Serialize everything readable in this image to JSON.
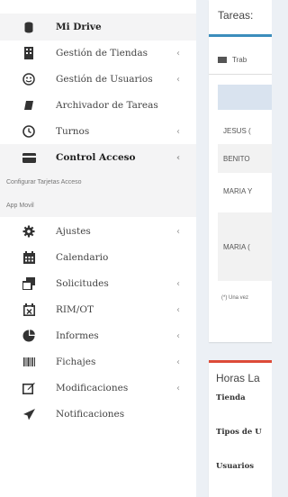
{
  "sidebar": {
    "items": [
      {
        "label": "Mi Drive",
        "icon": "database-icon",
        "chevron": ""
      },
      {
        "label": "Gestión de Tiendas",
        "icon": "building-icon",
        "chevron": "‹"
      },
      {
        "label": "Gestión de Usuarios",
        "icon": "smiley-icon",
        "chevron": "‹"
      },
      {
        "label": "Archivador de Tareas",
        "icon": "archive-icon",
        "chevron": ""
      },
      {
        "label": "Turnos",
        "icon": "clock-icon",
        "chevron": "‹"
      },
      {
        "label": "Control Acceso",
        "icon": "credit-card-icon",
        "chevron": "‹"
      },
      {
        "label": "Ajustes",
        "icon": "gear-icon",
        "chevron": "‹"
      },
      {
        "label": "Calendario",
        "icon": "calendar-icon",
        "chevron": ""
      },
      {
        "label": "Solicitudes",
        "icon": "clone-icon",
        "chevron": "‹"
      },
      {
        "label": "RIM/OT",
        "icon": "calendar-x-icon",
        "chevron": "‹"
      },
      {
        "label": "Informes",
        "icon": "pie-chart-icon",
        "chevron": "‹"
      },
      {
        "label": "Fichajes",
        "icon": "barcode-icon",
        "chevron": "‹"
      },
      {
        "label": "Modificaciones",
        "icon": "edit-icon",
        "chevron": "‹"
      },
      {
        "label": "Notificaciones",
        "icon": "paper-plane-icon",
        "chevron": ""
      }
    ],
    "subitems": [
      {
        "label": "Configurar Tarjetas Acceso"
      },
      {
        "label": "App Movil"
      }
    ]
  },
  "main": {
    "tasks_box": {
      "title": "Tareas:",
      "tab_label": "Trab",
      "rows": [
        "JESUS (",
        "BENITO",
        "MARIA Y",
        "MARIA ("
      ],
      "note": "(*) Una vez"
    },
    "hours_box": {
      "title": "Horas La",
      "fields": [
        "Tienda",
        "Tipos de U",
        "Usuarios"
      ]
    }
  },
  "colors": {
    "accent_blue": "#3c8dbc",
    "accent_red": "#dd4b39",
    "background": "#ecf0f5"
  }
}
